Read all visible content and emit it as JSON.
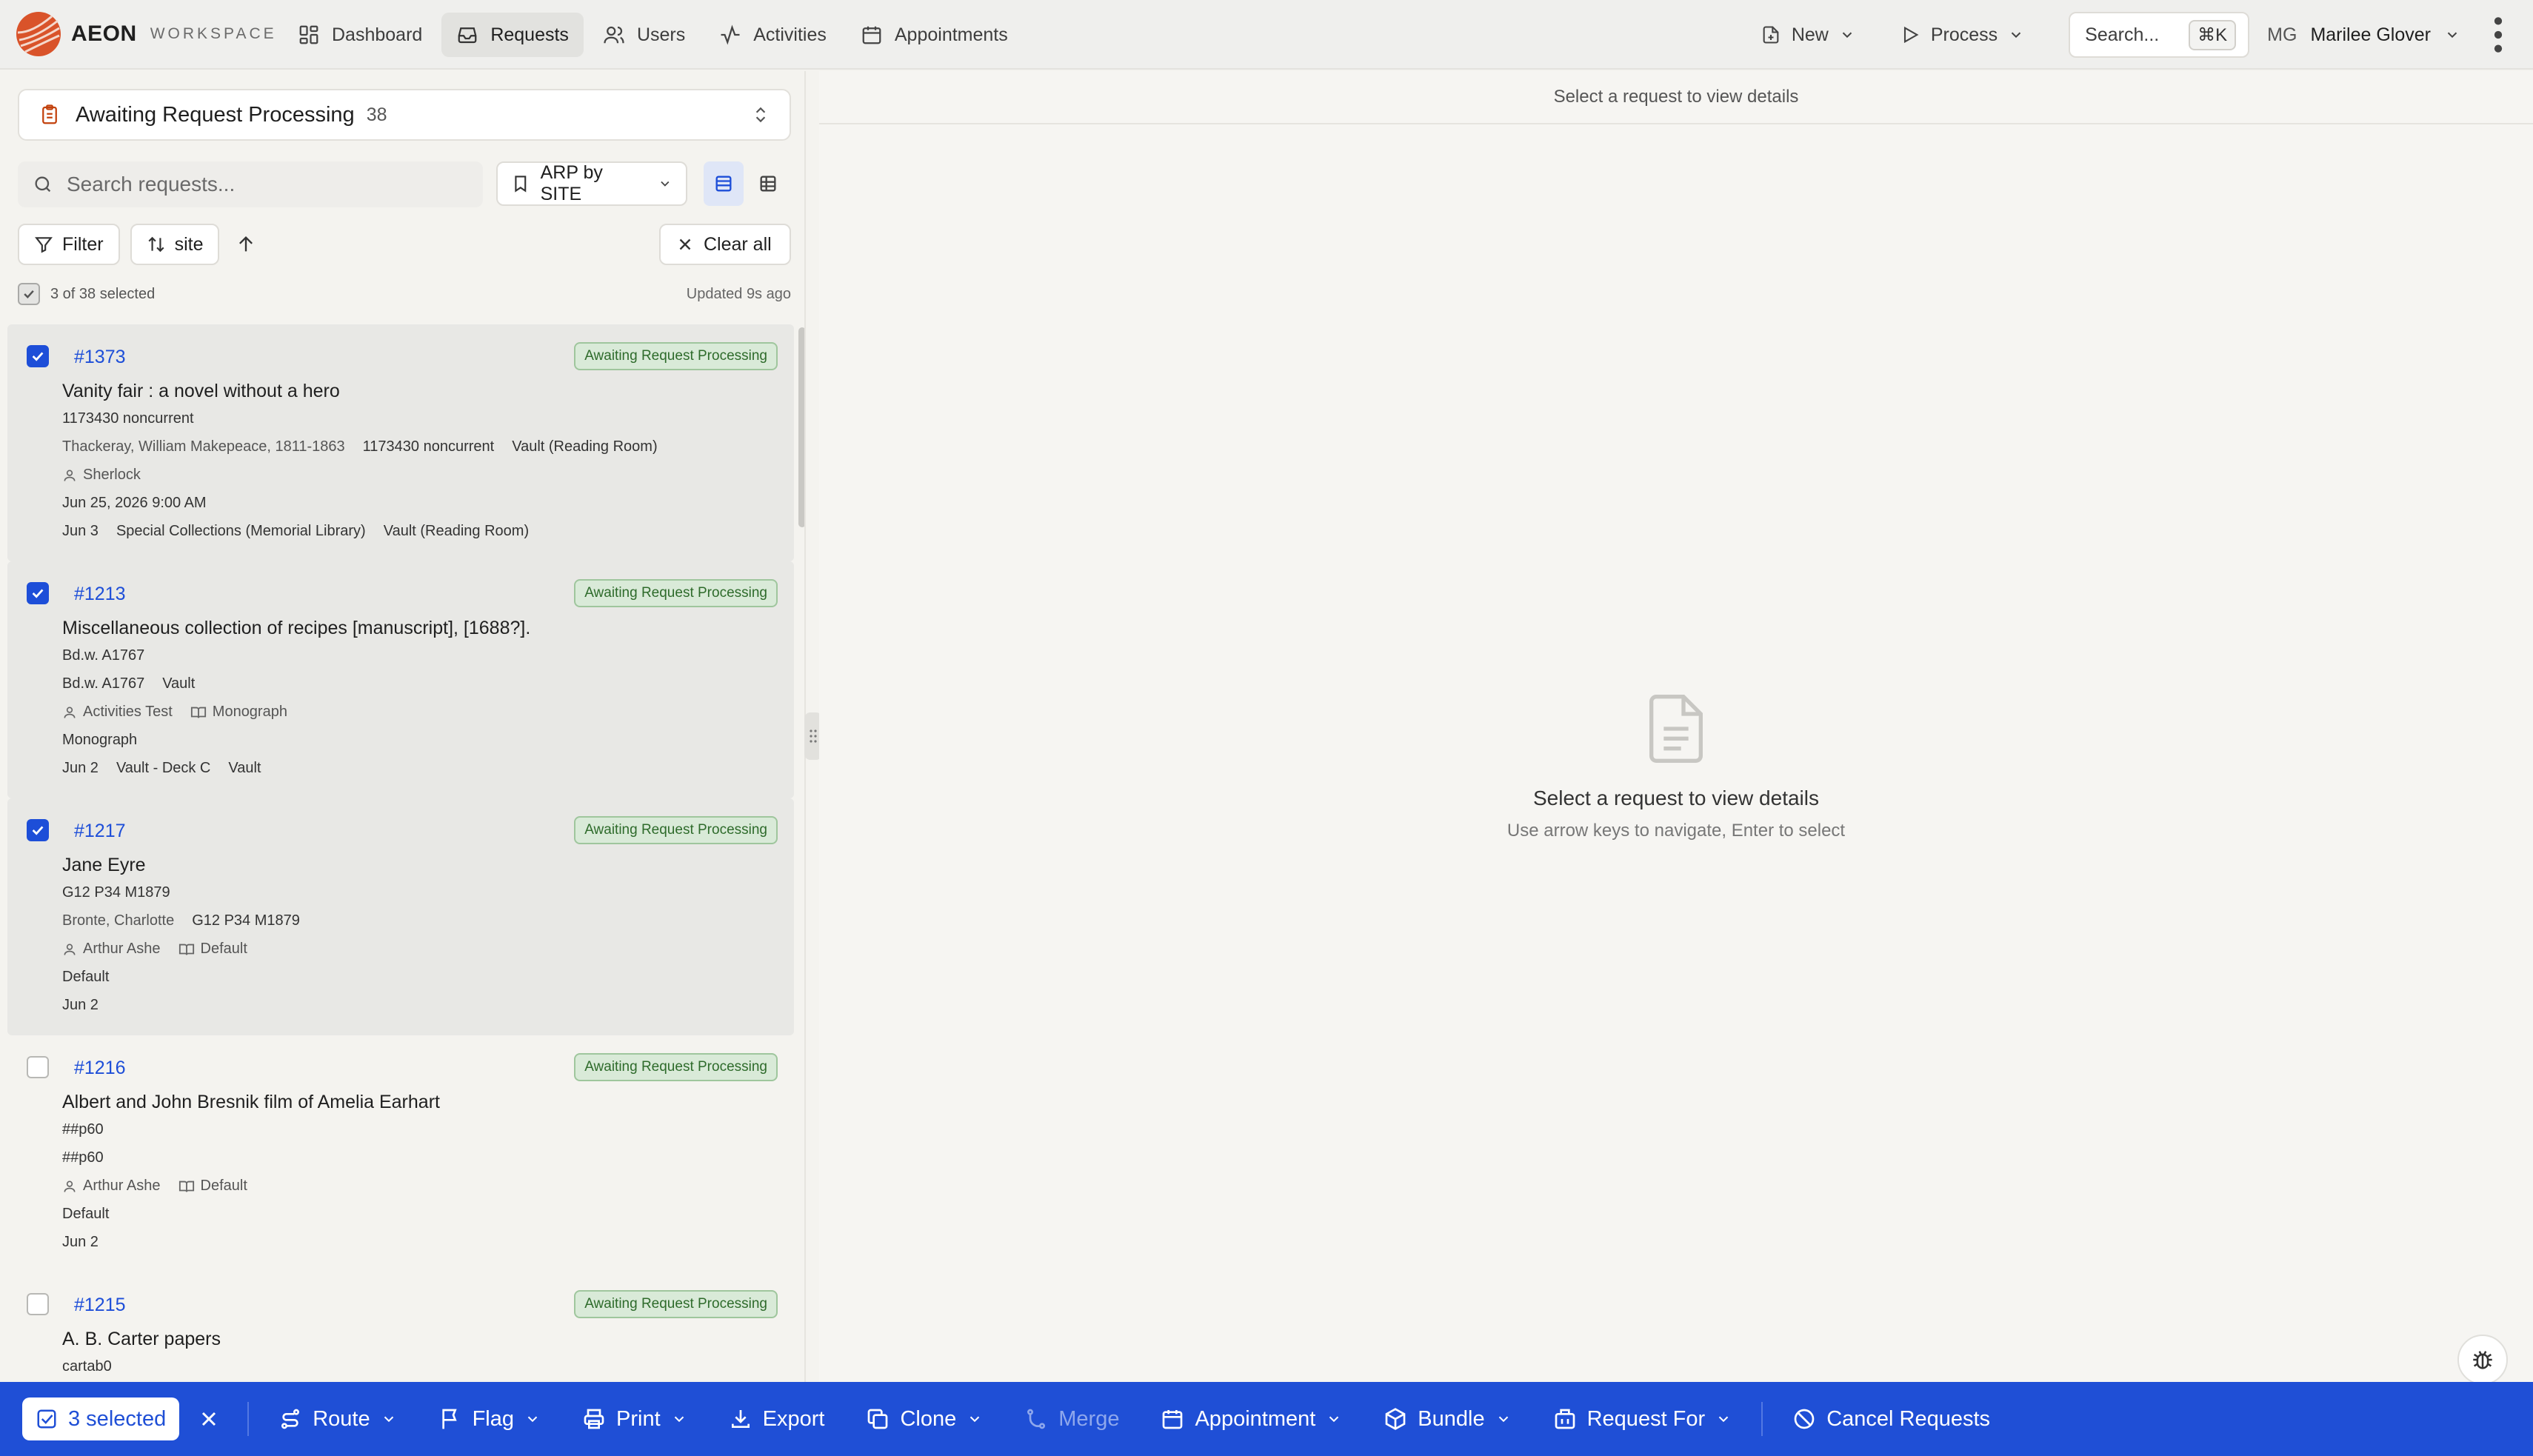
{
  "app": {
    "name": "AEON",
    "subtitle": "WORKSPACE"
  },
  "nav": [
    {
      "label": "Dashboard",
      "icon": "dashboard-icon"
    },
    {
      "label": "Requests",
      "icon": "inbox-icon",
      "active": true
    },
    {
      "label": "Users",
      "icon": "users-icon"
    },
    {
      "label": "Activities",
      "icon": "activity-icon"
    },
    {
      "label": "Appointments",
      "icon": "calendar-icon"
    }
  ],
  "topright": {
    "new_label": "New",
    "process_label": "Process",
    "search_label": "Search...",
    "search_shortcut": "⌘K",
    "user_initials": "MG",
    "user_name": "Marilee Glover"
  },
  "queue": {
    "title": "Awaiting Request Processing",
    "count": "38"
  },
  "search": {
    "placeholder": "Search requests..."
  },
  "saved_search": {
    "label": "ARP by SITE"
  },
  "filters": {
    "filter_label": "Filter",
    "sort_label": "site",
    "clear_label": "Clear all"
  },
  "selection": {
    "summary": "3 of 38 selected",
    "updated": "Updated 9s ago"
  },
  "requests": [
    {
      "id": "#1373",
      "selected": true,
      "status": "Awaiting Request Processing",
      "title": "Vanity fair : a novel without a hero",
      "callno": "1173430 noncurrent",
      "line2": [
        "Thackeray, William Makepeace, 1811-1863",
        "1173430 noncurrent",
        "Vault (Reading Room)"
      ],
      "user": "Sherlock",
      "format": "",
      "line4": "",
      "datetime": "Jun 25, 2026 9:00 AM",
      "footer": [
        "Jun 3",
        "Special Collections (Memorial Library)",
        "Vault (Reading Room)"
      ]
    },
    {
      "id": "#1213",
      "selected": true,
      "status": "Awaiting Request Processing",
      "title": "Miscellaneous collection of recipes [manuscript], [1688?].",
      "callno": "Bd.w. A1767",
      "line2": [
        "Bd.w. A1767",
        "Vault"
      ],
      "user": "Activities Test",
      "format": "Monograph",
      "line4": "Monograph",
      "datetime": "",
      "footer": [
        "Jun 2",
        "Vault - Deck C",
        "Vault"
      ]
    },
    {
      "id": "#1217",
      "selected": true,
      "status": "Awaiting Request Processing",
      "title": "Jane Eyre",
      "callno": "G12 P34 M1879",
      "line2": [
        "Bronte, Charlotte",
        "G12 P34 M1879"
      ],
      "user": "Arthur Ashe",
      "format": "Default",
      "line4": "Default",
      "datetime": "",
      "footer": [
        "Jun 2"
      ]
    },
    {
      "id": "#1216",
      "selected": false,
      "status": "Awaiting Request Processing",
      "title": "Albert and John Bresnik film of Amelia Earhart",
      "callno": "##p60",
      "line2": [
        "##p60"
      ],
      "user": "Arthur Ashe",
      "format": "Default",
      "line4": "Default",
      "datetime": "",
      "footer": [
        "Jun 2"
      ]
    },
    {
      "id": "#1215",
      "selected": false,
      "status": "Awaiting Request Processing",
      "title": "A. B. Carter papers",
      "callno": "cartab0",
      "line2": [],
      "user": "",
      "format": "",
      "line4": "",
      "datetime": "",
      "footer": []
    }
  ],
  "detail": {
    "header": "Select a request to view details",
    "empty_title": "Select a request to view details",
    "empty_sub": "Use arrow keys to navigate, Enter to select"
  },
  "bottombar": {
    "selected_label": "3 selected",
    "actions": [
      {
        "label": "Route",
        "icon": "route-icon",
        "dropdown": true
      },
      {
        "label": "Flag",
        "icon": "flag-icon",
        "dropdown": true
      },
      {
        "label": "Print",
        "icon": "printer-icon",
        "dropdown": true
      },
      {
        "label": "Export",
        "icon": "download-icon",
        "dropdown": false
      },
      {
        "label": "Clone",
        "icon": "copy-icon",
        "dropdown": true
      },
      {
        "label": "Merge",
        "icon": "merge-icon",
        "dropdown": false,
        "disabled": true
      },
      {
        "label": "Appointment",
        "icon": "calendar-icon",
        "dropdown": true
      },
      {
        "label": "Bundle",
        "icon": "package-icon",
        "dropdown": true
      },
      {
        "label": "Request For",
        "icon": "building-icon",
        "dropdown": true
      }
    ],
    "cancel_label": "Cancel Requests"
  },
  "colors": {
    "accent": "#1d4ed8",
    "bottombar": "#1f4fd6",
    "status_bg": "#d9ead8",
    "status_text": "#2e6b2b",
    "logo": "#d9532a"
  }
}
